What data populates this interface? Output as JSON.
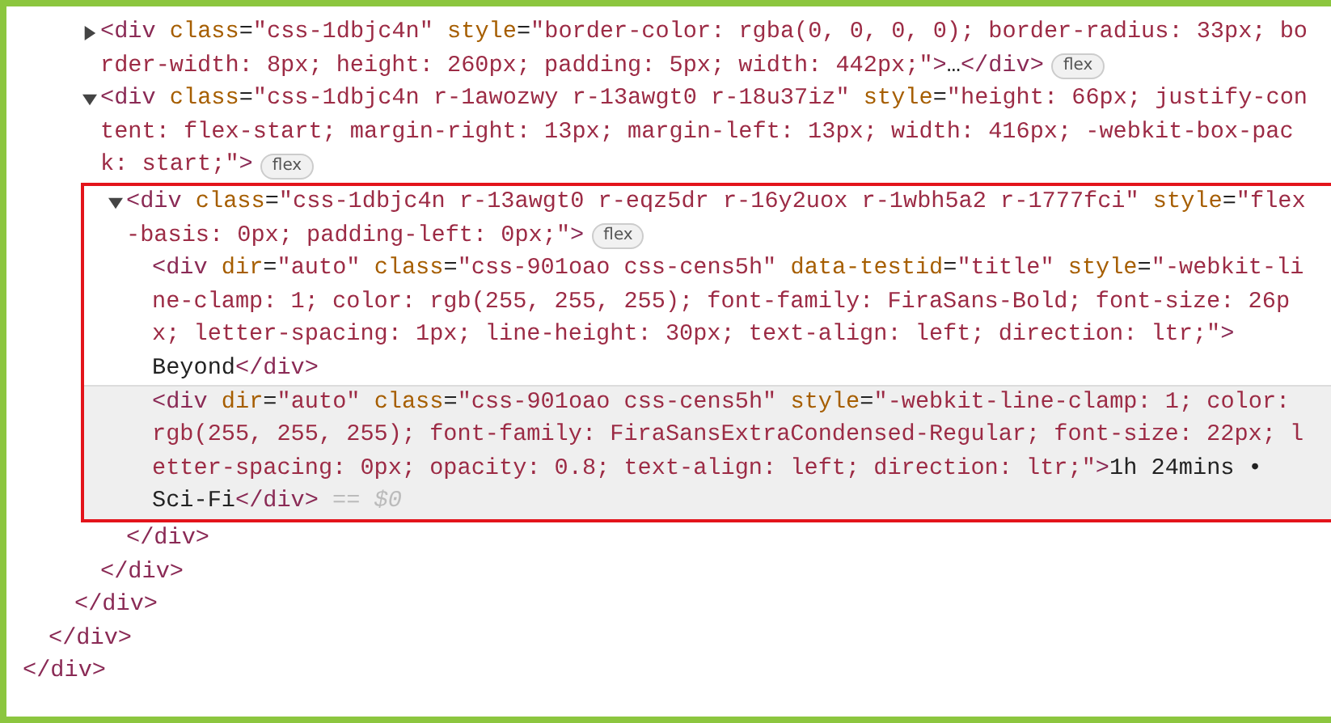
{
  "dom_tree": [
    {
      "close": "</div>",
      "children": [
        {
          "close": "</div>",
          "children": [
            {
              "close": "</div>",
              "children": [
                {
                  "expanded": false,
                  "selected": false,
                  "highlighted": false,
                  "lines": [
                    {
                      "code": [
                        {
                          "kind": "tag",
                          "text": "<div"
                        },
                        {
                          "kind": "attr",
                          "text": " class"
                        },
                        {
                          "kind": "text",
                          "text": "="
                        },
                        {
                          "kind": "value",
                          "text": "\"css-1dbjc4n\""
                        },
                        {
                          "kind": "attr",
                          "text": " style"
                        },
                        {
                          "kind": "text",
                          "text": "="
                        },
                        {
                          "kind": "value",
                          "text": "\"border-color: rgba(0, 0, 0, 0); border-radius: 33px; bo"
                        }
                      ]
                    },
                    {
                      "code": [
                        {
                          "kind": "value",
                          "text": "rder-width: 8px; height: 260px; padding: 5px; width: 442px;\""
                        },
                        {
                          "kind": "tag",
                          "text": ">"
                        },
                        {
                          "kind": "text",
                          "text": "…"
                        },
                        {
                          "kind": "tag",
                          "text": "</div>"
                        }
                      ],
                      "badge": "flex"
                    }
                  ]
                },
                {
                  "expanded": true,
                  "selected": false,
                  "highlighted": false,
                  "lines": [
                    {
                      "code": [
                        {
                          "kind": "tag",
                          "text": "<div"
                        },
                        {
                          "kind": "attr",
                          "text": " class"
                        },
                        {
                          "kind": "text",
                          "text": "="
                        },
                        {
                          "kind": "value",
                          "text": "\"css-1dbjc4n r-1awozwy r-13awgt0 r-18u37iz\""
                        },
                        {
                          "kind": "attr",
                          "text": " style"
                        },
                        {
                          "kind": "text",
                          "text": "="
                        },
                        {
                          "kind": "value",
                          "text": "\"height: 66px; justify-con"
                        }
                      ]
                    },
                    {
                      "code": [
                        {
                          "kind": "value",
                          "text": "tent: flex-start; margin-right: 13px; margin-left: 13px; width: 416px; -webkit-box-pac"
                        }
                      ]
                    },
                    {
                      "code": [
                        {
                          "kind": "value",
                          "text": "k: start;\""
                        },
                        {
                          "kind": "tag",
                          "text": ">"
                        }
                      ],
                      "badge": "flex"
                    }
                  ],
                  "close": "</div>",
                  "children": [
                    {
                      "expanded": true,
                      "selected": false,
                      "highlighted": true,
                      "lines": [
                        {
                          "code": [
                            {
                              "kind": "tag",
                              "text": "<div"
                            },
                            {
                              "kind": "attr",
                              "text": " class"
                            },
                            {
                              "kind": "text",
                              "text": "="
                            },
                            {
                              "kind": "value",
                              "text": "\"css-1dbjc4n r-13awgt0 r-eqz5dr r-16y2uox r-1wbh5a2 r-1777fci\""
                            },
                            {
                              "kind": "attr",
                              "text": " style"
                            },
                            {
                              "kind": "text",
                              "text": "="
                            },
                            {
                              "kind": "value",
                              "text": "\"flex"
                            }
                          ]
                        },
                        {
                          "code": [
                            {
                              "kind": "value",
                              "text": "-basis: 0px; padding-left: 0px;\""
                            },
                            {
                              "kind": "tag",
                              "text": ">"
                            }
                          ],
                          "badge": "flex"
                        }
                      ],
                      "close": "</div>",
                      "children": [
                        {
                          "selected": false,
                          "highlighted": false,
                          "lines": [
                            {
                              "code": [
                                {
                                  "kind": "tag",
                                  "text": "<div"
                                },
                                {
                                  "kind": "attr",
                                  "text": " dir"
                                },
                                {
                                  "kind": "text",
                                  "text": "="
                                },
                                {
                                  "kind": "value",
                                  "text": "\"auto\""
                                },
                                {
                                  "kind": "attr",
                                  "text": " class"
                                },
                                {
                                  "kind": "text",
                                  "text": "="
                                },
                                {
                                  "kind": "value",
                                  "text": "\"css-901oao css-cens5h\""
                                },
                                {
                                  "kind": "attr",
                                  "text": " data-testid"
                                },
                                {
                                  "kind": "text",
                                  "text": "="
                                },
                                {
                                  "kind": "value",
                                  "text": "\"title\""
                                },
                                {
                                  "kind": "attr",
                                  "text": " style"
                                },
                                {
                                  "kind": "text",
                                  "text": "="
                                },
                                {
                                  "kind": "value",
                                  "text": "\"-webkit-li"
                                }
                              ]
                            },
                            {
                              "code": [
                                {
                                  "kind": "value",
                                  "text": "ne-clamp: 1; color: rgb(255, 255, 255); font-family: FiraSans-Bold; font-size: 26p"
                                }
                              ]
                            },
                            {
                              "code": [
                                {
                                  "kind": "value",
                                  "text": "x; letter-spacing: 1px; line-height: 30px; text-align: left; direction: ltr;\""
                                },
                                {
                                  "kind": "tag",
                                  "text": ">"
                                }
                              ]
                            },
                            {
                              "code": [
                                {
                                  "kind": "text",
                                  "text": "Beyond"
                                },
                                {
                                  "kind": "tag",
                                  "text": "</div>"
                                }
                              ]
                            }
                          ]
                        },
                        {
                          "selected": true,
                          "highlighted": false,
                          "lines": [
                            {
                              "code": [
                                {
                                  "kind": "tag",
                                  "text": "<div"
                                },
                                {
                                  "kind": "attr",
                                  "text": " dir"
                                },
                                {
                                  "kind": "text",
                                  "text": "="
                                },
                                {
                                  "kind": "value",
                                  "text": "\"auto\""
                                },
                                {
                                  "kind": "attr",
                                  "text": " class"
                                },
                                {
                                  "kind": "text",
                                  "text": "="
                                },
                                {
                                  "kind": "value",
                                  "text": "\"css-901oao css-cens5h\""
                                },
                                {
                                  "kind": "attr",
                                  "text": " style"
                                },
                                {
                                  "kind": "text",
                                  "text": "="
                                },
                                {
                                  "kind": "value",
                                  "text": "\"-webkit-line-clamp: 1; color:"
                                }
                              ]
                            },
                            {
                              "code": [
                                {
                                  "kind": "value",
                                  "text": "rgb(255, 255, 255); font-family: FiraSansExtraCondensed-Regular; font-size: 22px; l"
                                }
                              ]
                            },
                            {
                              "code": [
                                {
                                  "kind": "value",
                                  "text": "etter-spacing: 0px; opacity: 0.8; text-align: left; direction: ltr;\""
                                },
                                {
                                  "kind": "tag",
                                  "text": ">"
                                },
                                {
                                  "kind": "text",
                                  "text": "1h 24mins •"
                                }
                              ]
                            },
                            {
                              "code": [
                                {
                                  "kind": "text",
                                  "text": "Sci-Fi"
                                },
                                {
                                  "kind": "tag",
                                  "text": "</div> "
                                },
                                {
                                  "kind": "comment",
                                  "text": "== $0"
                                }
                              ]
                            }
                          ]
                        }
                      ]
                    }
                  ]
                }
              ]
            }
          ]
        }
      ]
    }
  ]
}
